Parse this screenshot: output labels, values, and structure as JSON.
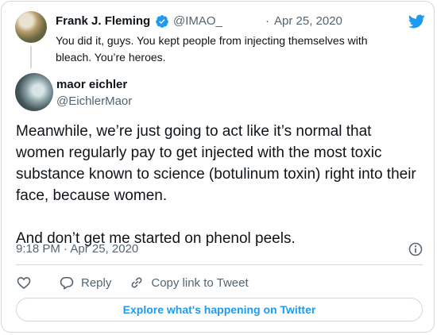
{
  "brand_color": "#1d9bf0",
  "logo_icon": "twitter-bird-icon",
  "parent_tweet": {
    "author_name": "Frank J. Fleming",
    "verified": true,
    "handle": "@IMAO_",
    "separator": "·",
    "date": "Apr 25, 2020",
    "text": "You did it, guys. You kept people from injecting themselves with bleach. You’re heroes."
  },
  "tweet": {
    "author_name": "maor eichler",
    "handle": "@EichlerMaor",
    "text_paragraph_1": "Meanwhile, we’re just going to act like it’s normal that women regularly pay to get injected with the most toxic substance known to science (botulinum toxin) right into their face, because women.",
    "text_paragraph_2": "And don’t get me started on phenol peels.",
    "timestamp": "9:18 PM · Apr 25, 2020"
  },
  "actions": {
    "like_icon": "heart-icon",
    "reply_label": "Reply",
    "copy_label": "Copy link to Tweet"
  },
  "explore_button": {
    "label": "Explore what's happening on Twitter"
  }
}
